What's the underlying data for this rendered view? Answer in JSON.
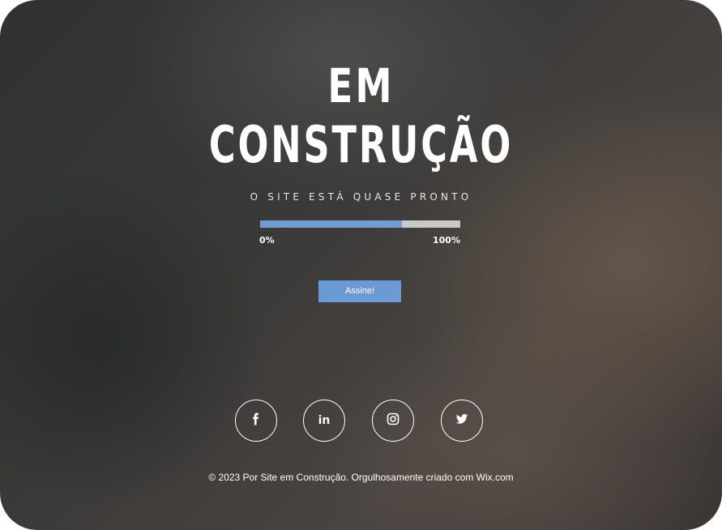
{
  "hero": {
    "title_line_1": "EM",
    "title_line_2": "CONSTRUÇÃO",
    "subtitle": "O SITE ESTÁ QUASE PRONTO"
  },
  "progress": {
    "value_fraction": 0.71,
    "min_label": "0%",
    "max_label": "100%",
    "fill_color": "#6e9ed3",
    "track_color": "#c9c9c9"
  },
  "cta": {
    "label": "Assine!",
    "color": "#6a9bd6"
  },
  "social": [
    {
      "name": "facebook",
      "icon": "facebook-icon"
    },
    {
      "name": "linkedin",
      "icon": "linkedin-icon"
    },
    {
      "name": "instagram",
      "icon": "instagram-icon"
    },
    {
      "name": "twitter",
      "icon": "twitter-icon"
    }
  ],
  "footer": {
    "text": "© 2023 Por Site em Construção. Orgulhosamente criado com Wix.com"
  }
}
